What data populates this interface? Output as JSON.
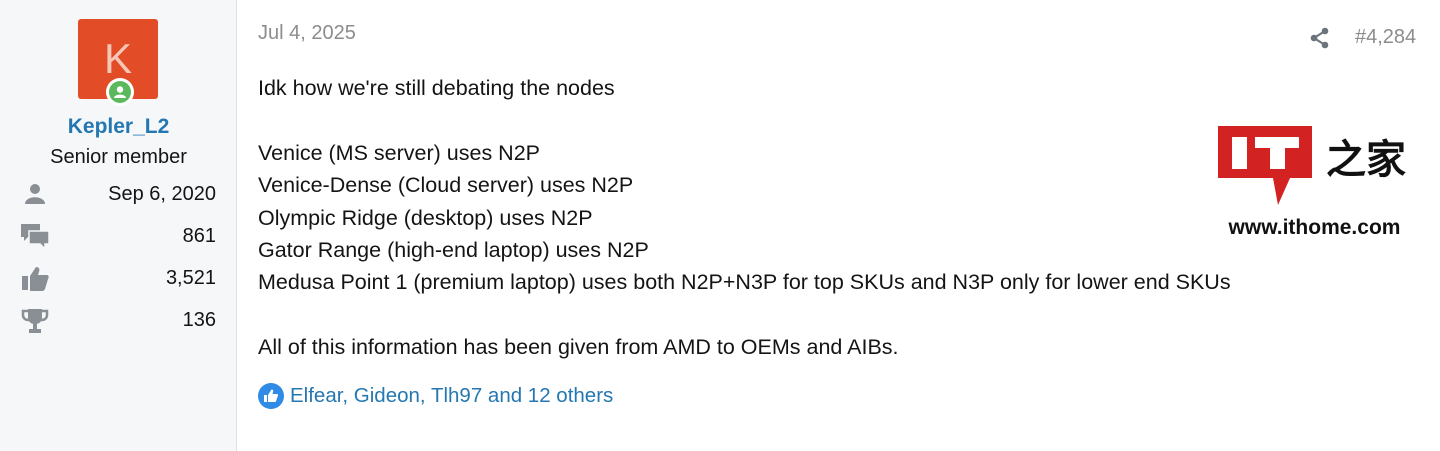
{
  "user": {
    "avatar_letter": "K",
    "username": "Kepler_L2",
    "title": "Senior member",
    "stats": [
      {
        "icon": "person-icon",
        "value": "Sep 6, 2020"
      },
      {
        "icon": "messages-icon",
        "value": "861"
      },
      {
        "icon": "thumbs-up-icon",
        "value": "3,521"
      },
      {
        "icon": "trophy-icon",
        "value": "136"
      }
    ]
  },
  "post": {
    "date": "Jul 4, 2025",
    "number": "#4,284",
    "lines": [
      "Idk how we're still debating the nodes",
      "",
      "Venice (MS server) uses N2P",
      "Venice-Dense (Cloud server) uses N2P",
      "Olympic Ridge (desktop) uses N2P",
      "Gator Range (high-end laptop) uses N2P",
      "Medusa Point 1 (premium laptop) uses both N2P+N3P for top SKUs and N3P only for lower end SKUs",
      "",
      "All of this information has been given from AMD to OEMs and AIBs."
    ],
    "reactions": "Elfear, Gideon, Tlh97 and 12 others"
  },
  "watermark": {
    "logo_text": "IT",
    "logo_chars": "之家",
    "url": "www.ithome.com"
  },
  "colors": {
    "link": "#2577b1",
    "avatar_bg": "#e24d27",
    "online": "#5cb85c",
    "logo_red": "#d22222"
  }
}
